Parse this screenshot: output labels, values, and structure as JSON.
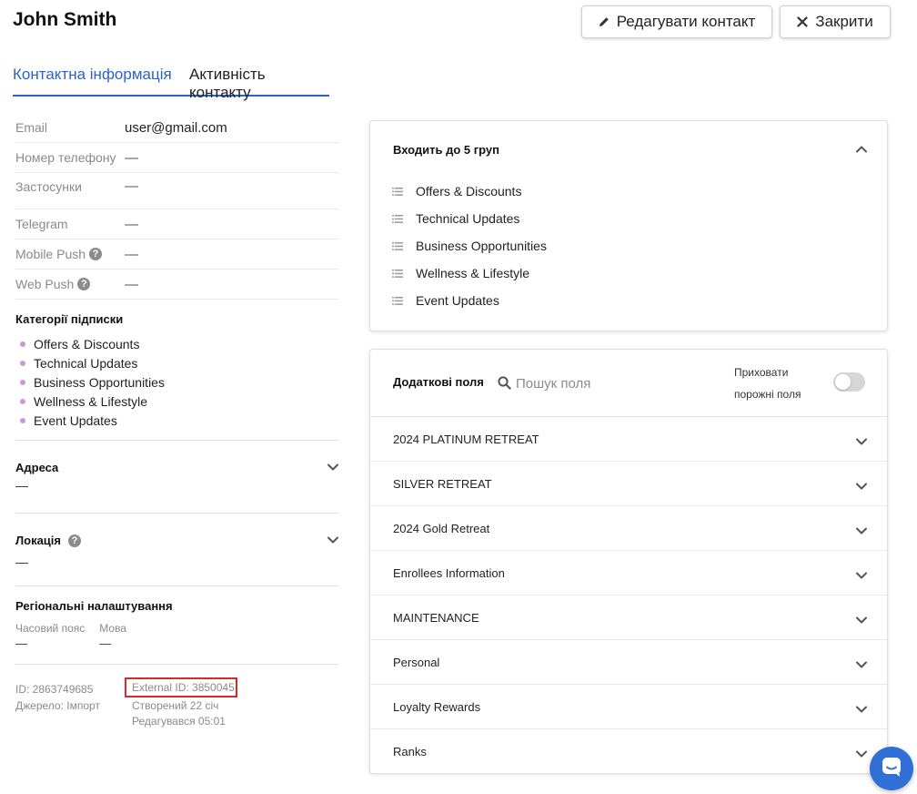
{
  "header": {
    "contact_name": "John Smith",
    "edit_label": "Редагувати контакт",
    "close_label": "Закрити"
  },
  "tabs": [
    {
      "label": "Контактна інформація",
      "active": true
    },
    {
      "label": "Активність контакту",
      "active": false
    }
  ],
  "contact_info": [
    {
      "label": "Email",
      "value": "user@gmail.com"
    },
    {
      "label": "Номер телефону",
      "value": "—"
    },
    {
      "label": "Застосунки",
      "value": "—"
    },
    {
      "label": "Telegram",
      "value": "—"
    },
    {
      "label": "Mobile Push",
      "value": "—",
      "help": true
    },
    {
      "label": "Web Push",
      "value": "—",
      "help": true
    }
  ],
  "subscription": {
    "title": "Категорії підписки",
    "items": [
      "Offers & Discounts",
      "Technical Updates",
      "Business Opportunities",
      "Wellness & Lifestyle",
      "Event Updates"
    ]
  },
  "address": {
    "title": "Адреса",
    "value": "—"
  },
  "location": {
    "title": "Локація",
    "value": "—"
  },
  "regional": {
    "title": "Регіональні налаштування",
    "timezone_label": "Часовий пояс",
    "timezone_value": "—",
    "language_label": "Мова",
    "language_value": "—"
  },
  "meta": {
    "id": "ID: 2863749685",
    "source": "Джерело:  Імпорт",
    "external_id": "External ID: 3850045",
    "created": "Створений 22 січ",
    "edited": "Редагувався 05:01"
  },
  "groups": {
    "title": "Входить до  5  груп",
    "items": [
      "Offers & Discounts",
      "Technical Updates",
      "Business Opportunities",
      "Wellness & Lifestyle",
      "Event Updates"
    ]
  },
  "custom_fields": {
    "title": "Додаткові поля",
    "search_placeholder": "Пошук поля",
    "hide_empty_line1": "Приховати",
    "hide_empty_line2": "порожні поля",
    "hide_empty_on": false,
    "sections": [
      "2024 PLATINUM RETREAT",
      "SILVER RETREAT",
      "2024 Gold Retreat",
      "Enrollees Information",
      "MAINTENANCE",
      "Personal",
      "Loyalty Rewards",
      "Ranks"
    ]
  },
  "colors": {
    "accent": "#2d62c8",
    "highlight_border": "#d82a2a",
    "bullet": "#c99ad6",
    "chat": "#2f6fd6"
  }
}
